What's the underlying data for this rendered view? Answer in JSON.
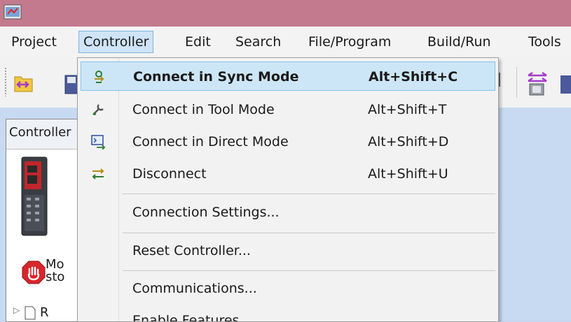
{
  "menubar": {
    "items": [
      {
        "label": "Project"
      },
      {
        "label": "Controller"
      },
      {
        "label": "Edit"
      },
      {
        "label": "Search"
      },
      {
        "label": "File/Program"
      },
      {
        "label": "Build/Run"
      },
      {
        "label": "Tools"
      }
    ],
    "active_index": 1
  },
  "controller_menu": {
    "items": [
      {
        "label": "Connect in Sync Mode",
        "shortcut": "Alt+Shift+C",
        "icon": "sync-connect-icon",
        "highlighted": true
      },
      {
        "label": "Connect in Tool Mode",
        "shortcut": "Alt+Shift+T",
        "icon": "tool-connect-icon"
      },
      {
        "label": "Connect in Direct Mode",
        "shortcut": "Alt+Shift+D",
        "icon": "direct-connect-icon"
      },
      {
        "label": "Disconnect",
        "shortcut": "Alt+Shift+U",
        "icon": "disconnect-icon"
      },
      {
        "label": "Connection Settings...",
        "shortcut": ""
      },
      {
        "label": "Reset Controller...",
        "shortcut": ""
      },
      {
        "label": "Communications...",
        "shortcut": ""
      },
      {
        "label": "Enable Features...",
        "shortcut": ""
      }
    ]
  },
  "left_panel": {
    "title": "Controller",
    "status_line1": "Mo",
    "status_line2": "sto",
    "tree_item": "R"
  },
  "colors": {
    "titlebar": "#c37a8e",
    "menu_highlight": "#cde6f7",
    "workspace": "#c8daf1"
  }
}
